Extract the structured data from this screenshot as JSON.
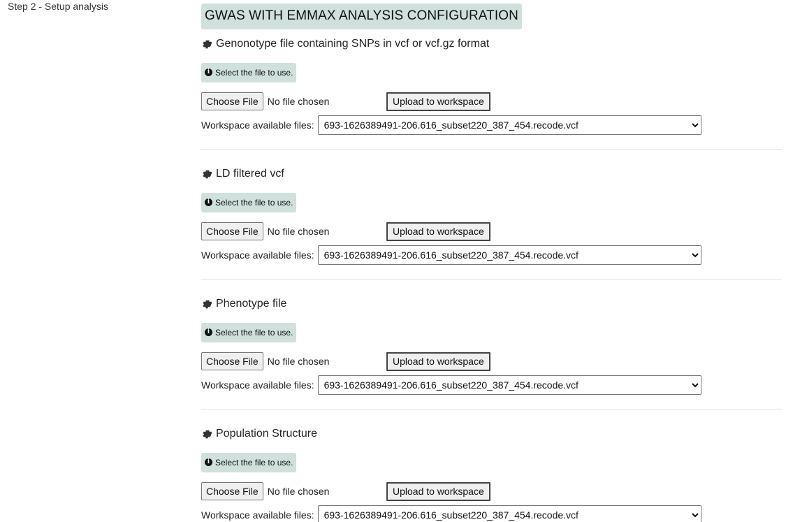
{
  "sidebar": {
    "step_label": "Step 2 - Setup analysis"
  },
  "main": {
    "title": "GWAS WITH EMMAX ANALYSIS CONFIGURATION",
    "sections": [
      {
        "heading": "Genonotype file containing SNPs in vcf or vcf.gz format",
        "hint": "Select the file to use.",
        "choose_label": "Choose File",
        "no_file_label": "No file chosen",
        "upload_label": "Upload to workspace",
        "workspace_label": "Workspace available files:",
        "selected_file": "693-1626389491-206.616_subset220_387_454.recode.vcf"
      },
      {
        "heading": "LD filtered vcf",
        "hint": "Select the file to use.",
        "choose_label": "Choose File",
        "no_file_label": "No file chosen",
        "upload_label": "Upload to workspace",
        "workspace_label": "Workspace available files:",
        "selected_file": "693-1626389491-206.616_subset220_387_454.recode.vcf"
      },
      {
        "heading": "Phenotype file",
        "hint": "Select the file to use.",
        "choose_label": "Choose File",
        "no_file_label": "No file chosen",
        "upload_label": "Upload to workspace",
        "workspace_label": "Workspace available files:",
        "selected_file": "693-1626389491-206.616_subset220_387_454.recode.vcf"
      },
      {
        "heading": "Population Structure",
        "hint": "Select the file to use.",
        "choose_label": "Choose File",
        "no_file_label": "No file chosen",
        "upload_label": "Upload to workspace",
        "workspace_label": "Workspace available files:",
        "selected_file": "693-1626389491-206.616_subset220_387_454.recode.vcf"
      }
    ]
  },
  "icons": {
    "section_icon": "gear-icon",
    "hint_icon": "info-circle-icon"
  },
  "colors": {
    "badge_bg": "#cfe0dd",
    "divider": "#dee2e6"
  }
}
